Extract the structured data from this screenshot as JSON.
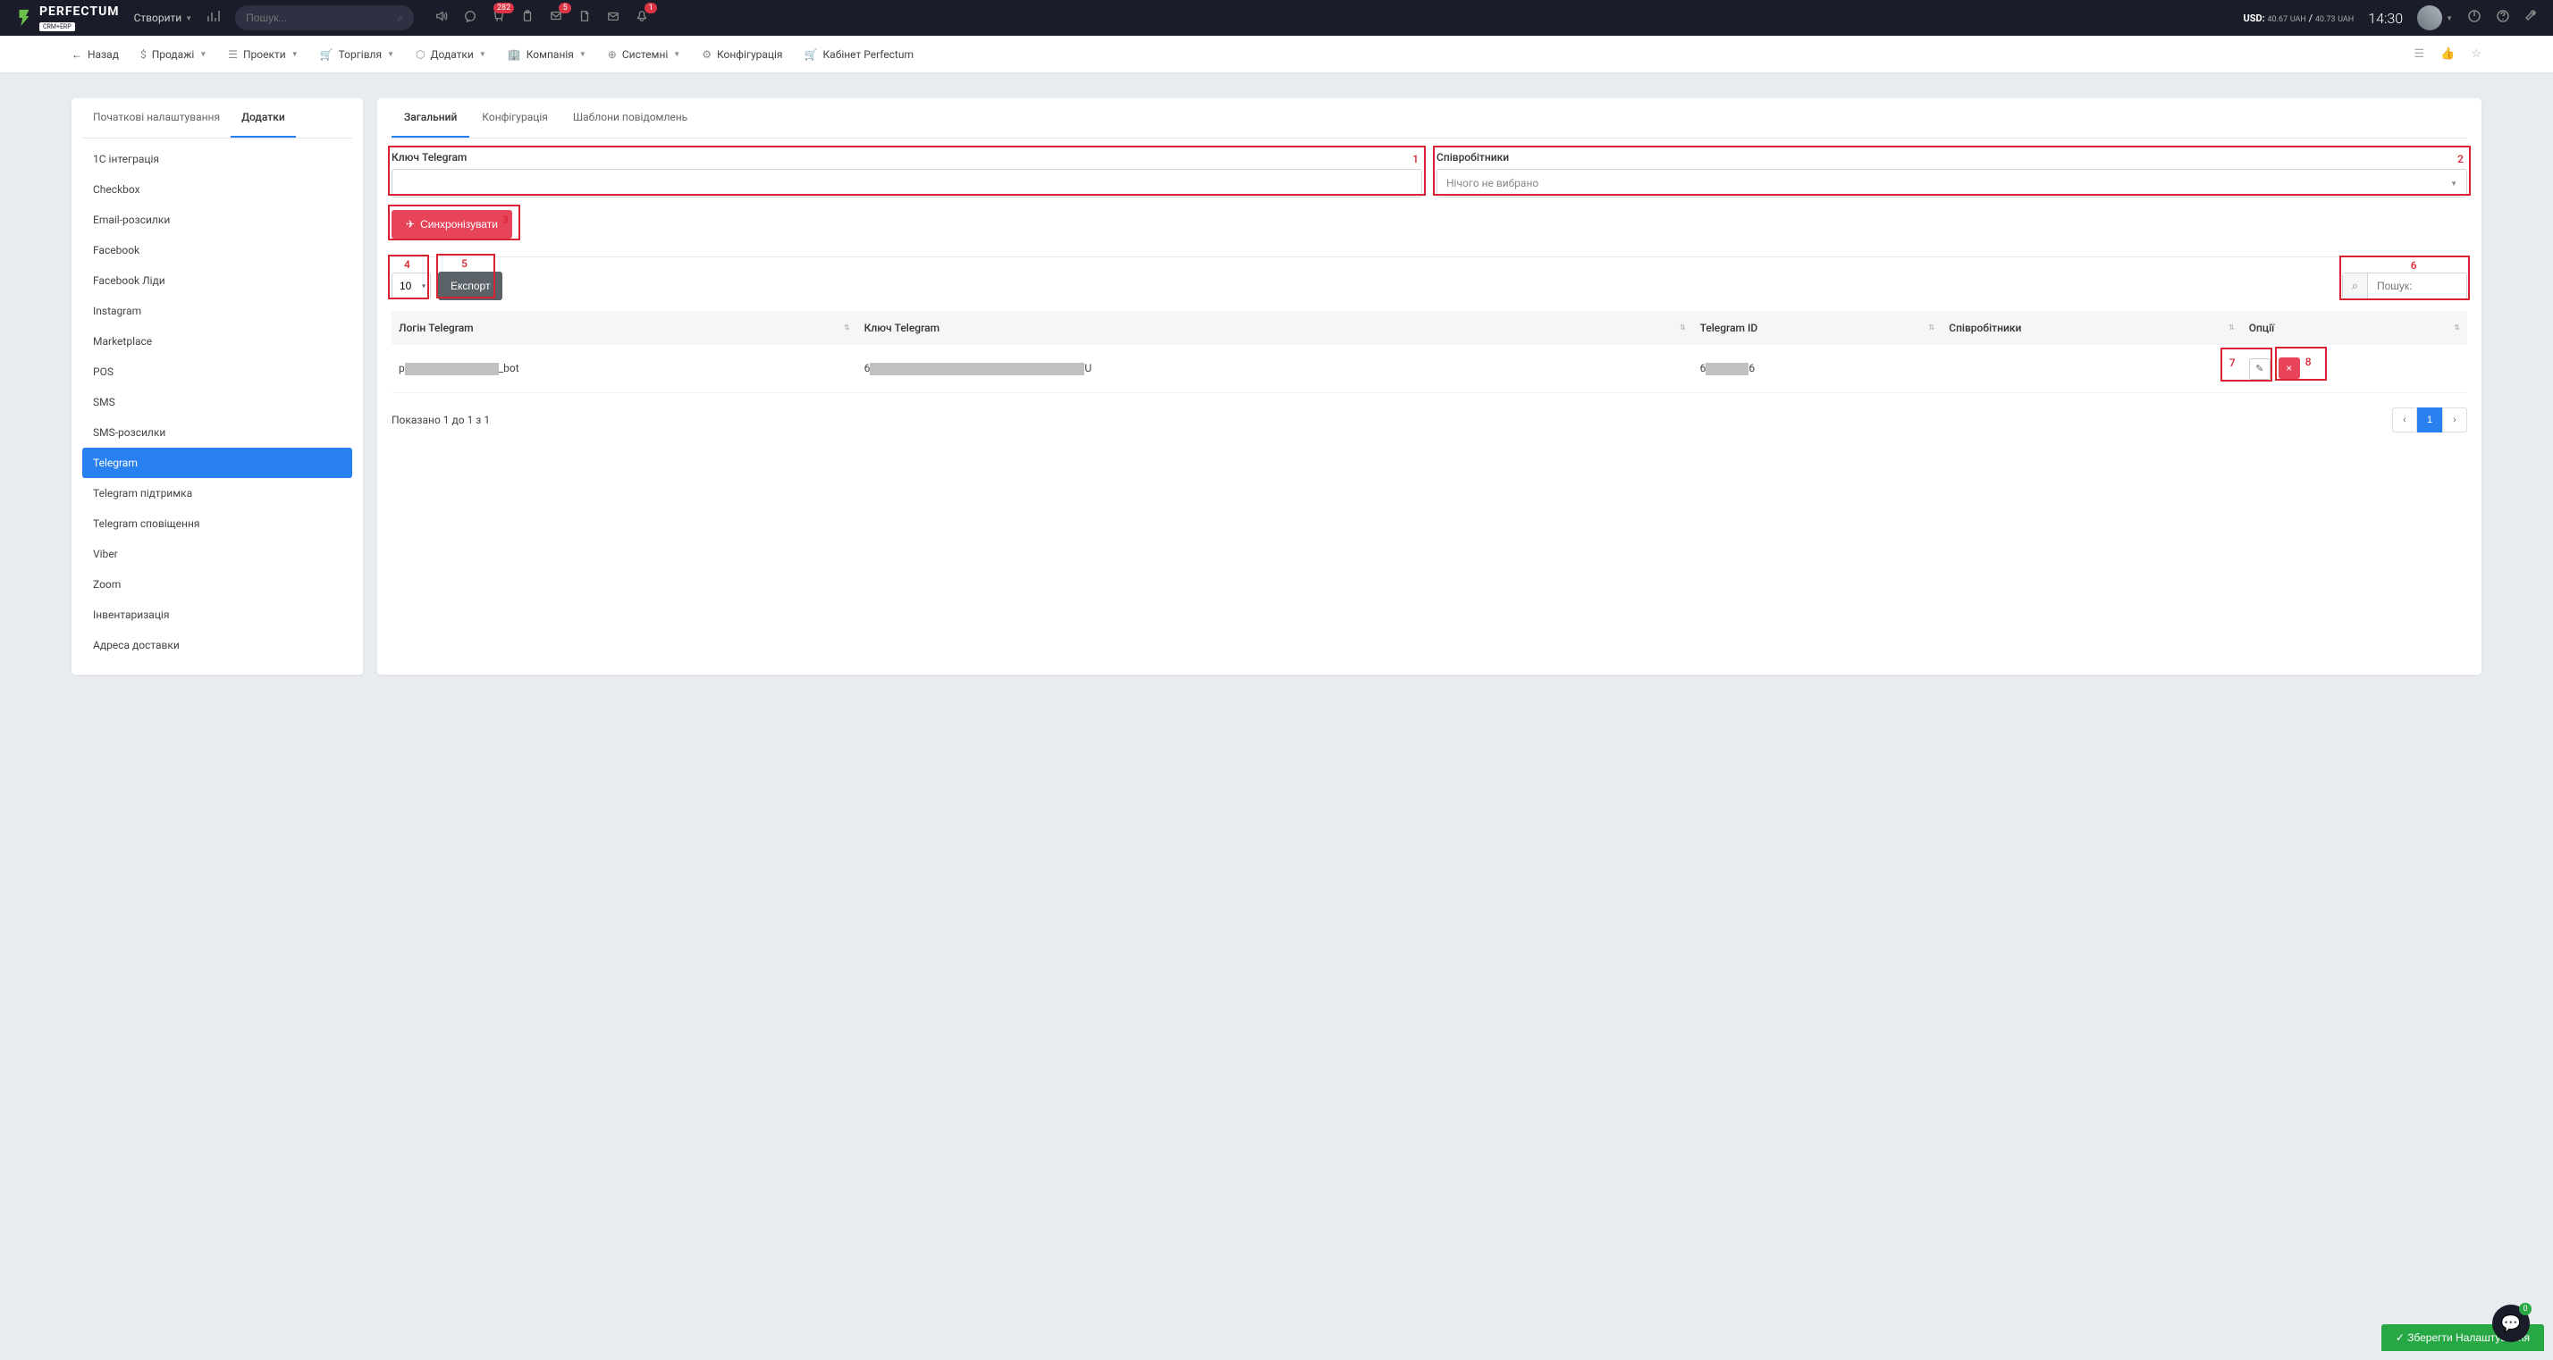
{
  "header": {
    "brand": "PERFECTUM",
    "brand_sub": "CRM+ERP",
    "create": "Створити",
    "search_placeholder": "Пошук...",
    "badges": {
      "cart": "282",
      "chat": "5",
      "bell": "1"
    },
    "currency": "USD: 40.67 UAH / 40.73 UAH",
    "currency_label_1": "USD:",
    "currency_val_1": "40.67",
    "currency_unit": "UAH",
    "currency_val_2": "40.73",
    "time": "14:30"
  },
  "nav": {
    "back": "Назад",
    "sales": "Продажі",
    "projects": "Проекти",
    "trade": "Торгівля",
    "addons": "Додатки",
    "company": "Компанія",
    "system": "Системні",
    "config": "Конфігурація",
    "cabinet": "Кабінет Perfectum"
  },
  "sidebar": {
    "tab_initial": "Початкові налаштування",
    "tab_addons": "Додатки",
    "items": [
      "1С інтеграція",
      "Checkbox",
      "Email-розсилки",
      "Facebook",
      "Facebook Ліди",
      "Instagram",
      "Marketplace",
      "POS",
      "SMS",
      "SMS-розсилки",
      "Telegram",
      "Telegram підтримка",
      "Telegram сповіщення",
      "Viber",
      "Zoom",
      "Інвентаризація",
      "Адреса доставки"
    ],
    "active_index": 10
  },
  "main": {
    "tab_general": "Загальний",
    "tab_config": "Конфігурація",
    "tab_templates": "Шаблони повідомлень",
    "key_label": "Ключ Telegram",
    "staff_label": "Співробітники",
    "staff_placeholder": "Нічого не вибрано",
    "sync_btn": "Синхронізувати",
    "pagesize": "10",
    "export_btn": "Експорт",
    "table_search_placeholder": "Пошук:",
    "annotations": {
      "a1": "1",
      "a2": "2",
      "a3": "3",
      "a4": "4",
      "a5": "5",
      "a6": "6",
      "a7": "7",
      "a8": "8"
    },
    "columns": {
      "login": "Логін Telegram",
      "key": "Ключ Telegram",
      "tid": "Telegram ID",
      "staff": "Співробітники",
      "options": "Опції"
    },
    "row": {
      "login_prefix": "p",
      "login_suffix": "_bot",
      "key_prefix": "6",
      "key_suffix": "U",
      "tid_prefix": "6",
      "tid_suffix": "6"
    },
    "result_text": "Показано 1 до 1 з 1",
    "page": "1"
  },
  "footer": {
    "save": "Зберегти Налаштування",
    "fab_badge": "0"
  }
}
